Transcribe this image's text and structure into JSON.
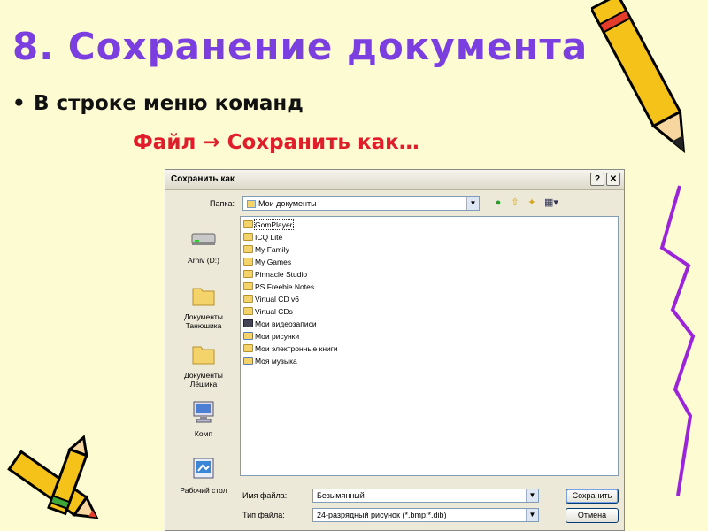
{
  "slide": {
    "title": "8. Сохранение документа",
    "bullet": "В строке меню команд",
    "menu_path": "Файл → Сохранить как…"
  },
  "dialog": {
    "title": "Сохранить как",
    "help": "?",
    "close": "✕",
    "folder_label": "Папка:",
    "folder_value": "Мои документы",
    "places": [
      {
        "label": "Arhiv (D:)",
        "icon": "drive-icon"
      },
      {
        "label": "Документы Танюшика",
        "icon": "folder-icon"
      },
      {
        "label": "Документы Лёшика",
        "icon": "folder-icon"
      },
      {
        "label": "Комп",
        "icon": "computer-icon"
      },
      {
        "label": "Рабочий стол",
        "icon": "desktop-icon"
      }
    ],
    "files": [
      "GomPlayer",
      "ICQ Lite",
      "My Family",
      "My Games",
      "Pinnacle Studio",
      "PS Freebie Notes",
      "Virtual CD v6",
      "Virtual CDs",
      "Мои видеозаписи",
      "Мои рисунки",
      "Мои электронные книги",
      "Моя музыка"
    ],
    "filename_label": "Имя файла:",
    "filename_value": "Безымянный",
    "filetype_label": "Тип файла:",
    "filetype_value": "24-разрядный рисунок (*.bmp;*.dib)",
    "save_button": "Сохранить",
    "cancel_button": "Отмена"
  }
}
